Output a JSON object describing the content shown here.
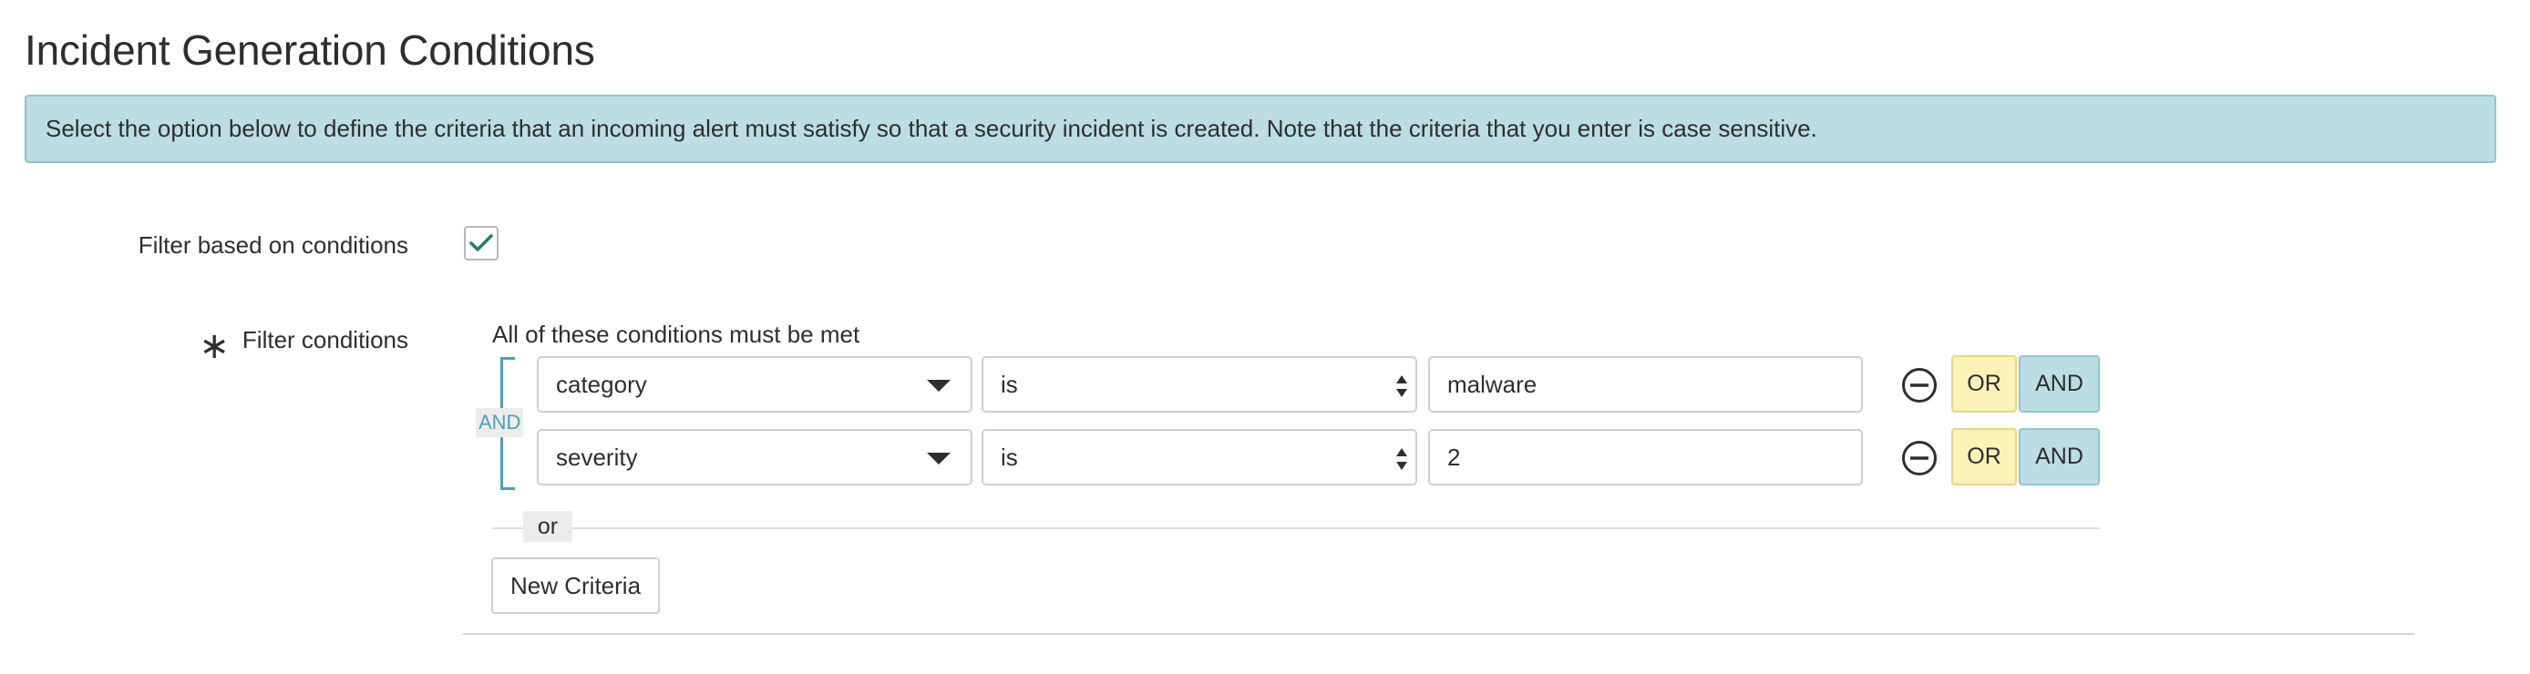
{
  "page": {
    "title": "Incident Generation Conditions",
    "info_text": "Select the option below to define the criteria that an incoming alert must satisfy so that a security incident is created. Note that the criteria that you enter is case sensitive."
  },
  "form": {
    "filter_based_label": "Filter based on conditions",
    "filter_based_checked": true,
    "filter_conditions_label": "Filter conditions",
    "conditions_caption": "All of these conditions must be met",
    "group_operator": "AND",
    "conditions": [
      {
        "field": "category",
        "operator": "is",
        "value": "malware",
        "or_label": "OR",
        "and_label": "AND"
      },
      {
        "field": "severity",
        "operator": "is",
        "value": "2",
        "or_label": "OR",
        "and_label": "AND"
      }
    ],
    "or_separator": "or",
    "new_criteria_label": "New Criteria"
  },
  "colors": {
    "info_bg": "#bcdde3",
    "and_accent": "#4e9fb5",
    "or_button_bg": "#fbf2b8",
    "and_button_bg": "#bcdde3",
    "check_color": "#2a7a72"
  },
  "icons": {
    "required": "asterisk-icon",
    "checkbox": "checkmark-icon",
    "remove": "minus-circle-icon",
    "dropdown": "caret-down-icon",
    "operator_select": "updown-arrows-icon"
  }
}
